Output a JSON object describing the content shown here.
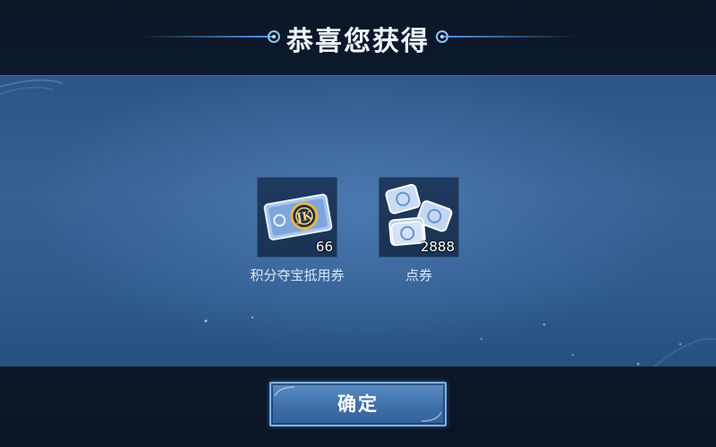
{
  "dialog": {
    "title": "恭喜您获得"
  },
  "rewards": [
    {
      "name": "积分夺宝抵用券",
      "count": "66",
      "icon": "ticket-icon"
    },
    {
      "name": "点券",
      "count": "2888",
      "icon": "coupon-stack-icon"
    }
  ],
  "actions": {
    "confirm_label": "确定"
  },
  "colors": {
    "panel_blue": "#375f92",
    "header_dark": "#0b1626",
    "button_blue": "#3f6fa9",
    "accent_glow": "#7fb2ea"
  }
}
